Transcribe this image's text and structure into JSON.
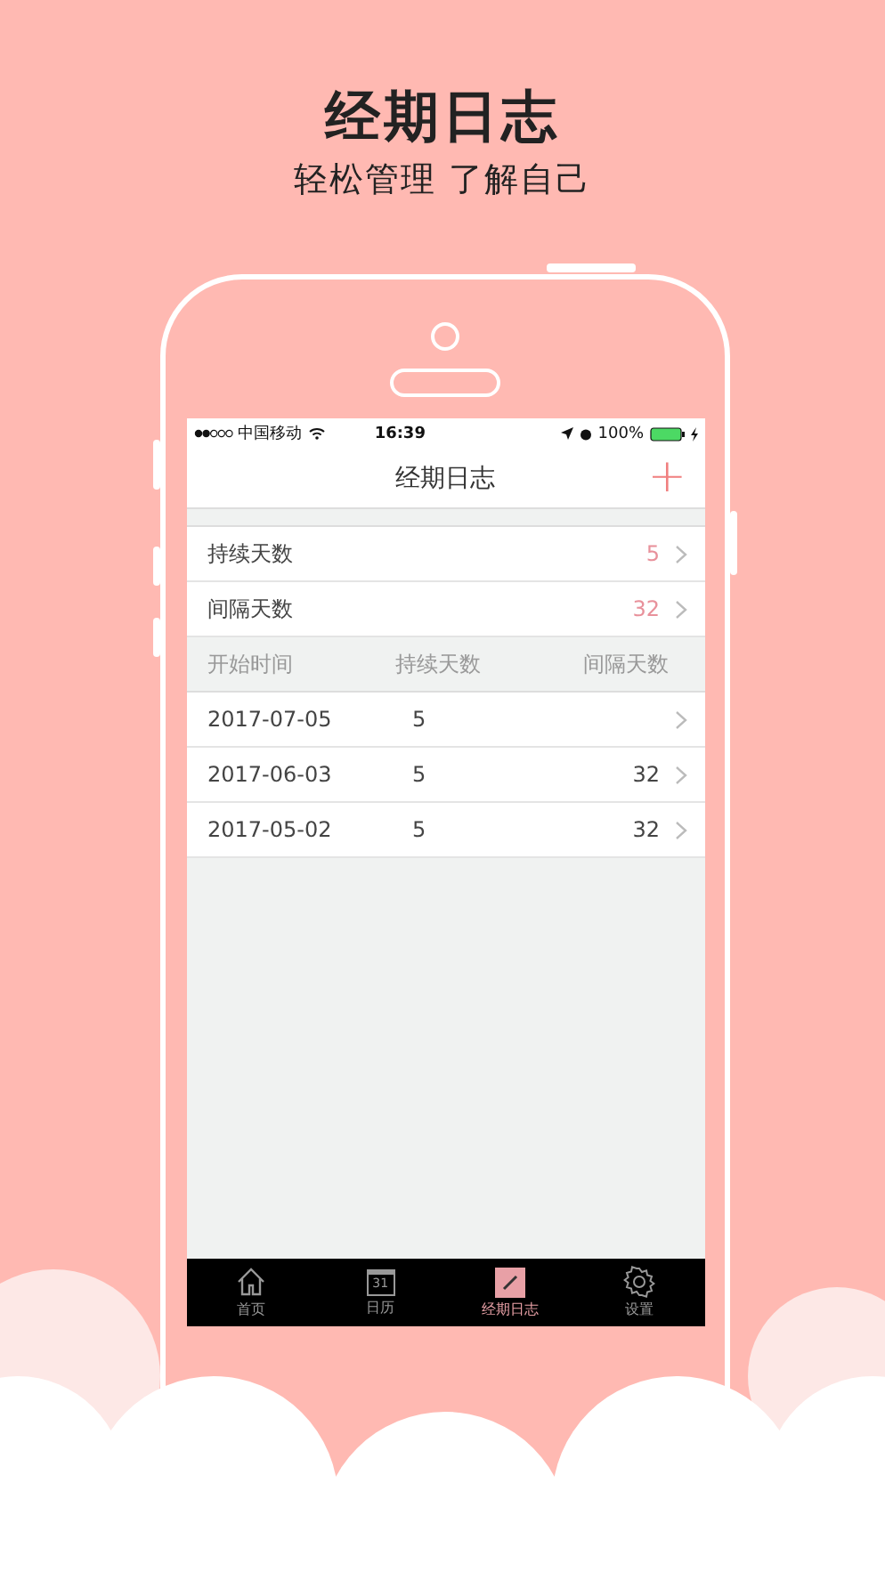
{
  "promo": {
    "title": "经期日志",
    "subtitle": "轻松管理 了解自己"
  },
  "status_bar": {
    "carrier": "中国移动",
    "time": "16:39",
    "battery": "100%"
  },
  "nav": {
    "title": "经期日志",
    "add": "+"
  },
  "summary": [
    {
      "label": "持续天数",
      "value": "5"
    },
    {
      "label": "间隔天数",
      "value": "32"
    }
  ],
  "table": {
    "columns": [
      "开始时间",
      "持续天数",
      "间隔天数"
    ],
    "rows": [
      [
        "2017-07-05",
        "5",
        ""
      ],
      [
        "2017-06-03",
        "5",
        "32"
      ],
      [
        "2017-05-02",
        "5",
        "32"
      ]
    ]
  },
  "tab_bar": [
    {
      "label": "首页",
      "kind": "home",
      "selected": false
    },
    {
      "label": "日历",
      "kind": "calendar",
      "icon_text": "31",
      "selected": false
    },
    {
      "label": "经期日志",
      "kind": "note",
      "selected": true
    },
    {
      "label": "设置",
      "kind": "gear",
      "selected": false
    }
  ]
}
